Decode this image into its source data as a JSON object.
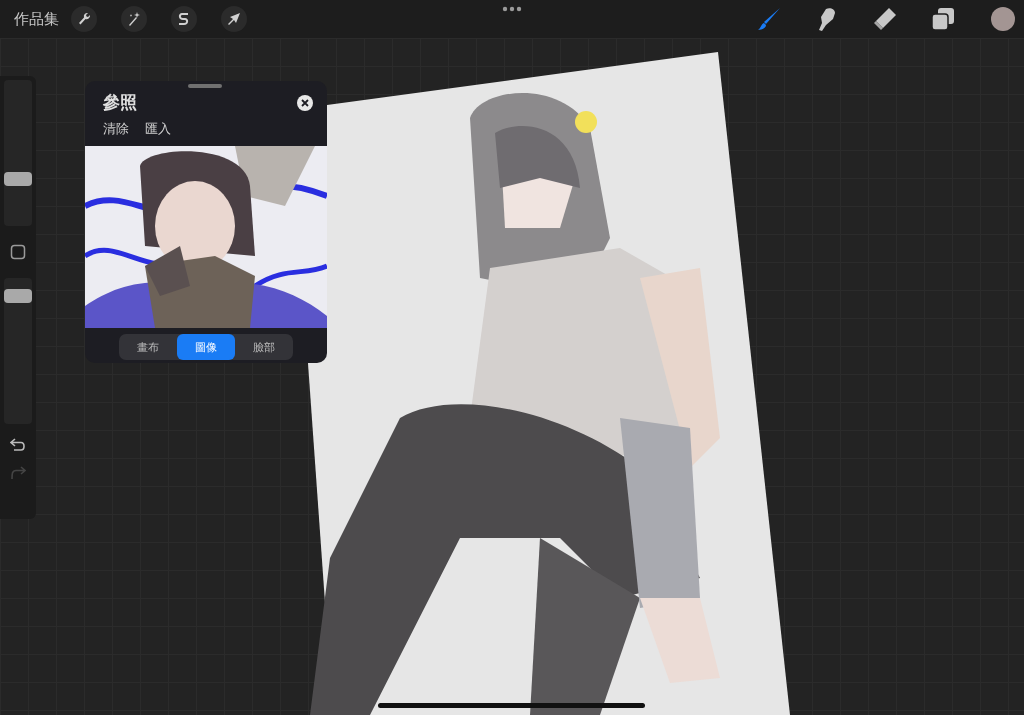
{
  "top_bar": {
    "gallery_label": "作品集",
    "tools": [
      {
        "kind": "brush",
        "selected": true
      },
      {
        "kind": "smudge",
        "selected": false
      },
      {
        "kind": "eraser",
        "selected": false
      },
      {
        "kind": "layers",
        "selected": false
      }
    ]
  },
  "sidebar": {
    "sliders": [
      {
        "level": 0.3
      },
      {
        "level": 0.92
      }
    ]
  },
  "reference_panel": {
    "title": "參照",
    "actions": [
      "清除",
      "匯入"
    ],
    "tabs": [
      {
        "label": "畫布",
        "selected": false
      },
      {
        "label": "圖像",
        "selected": true
      },
      {
        "label": "臉部",
        "selected": false
      }
    ]
  }
}
